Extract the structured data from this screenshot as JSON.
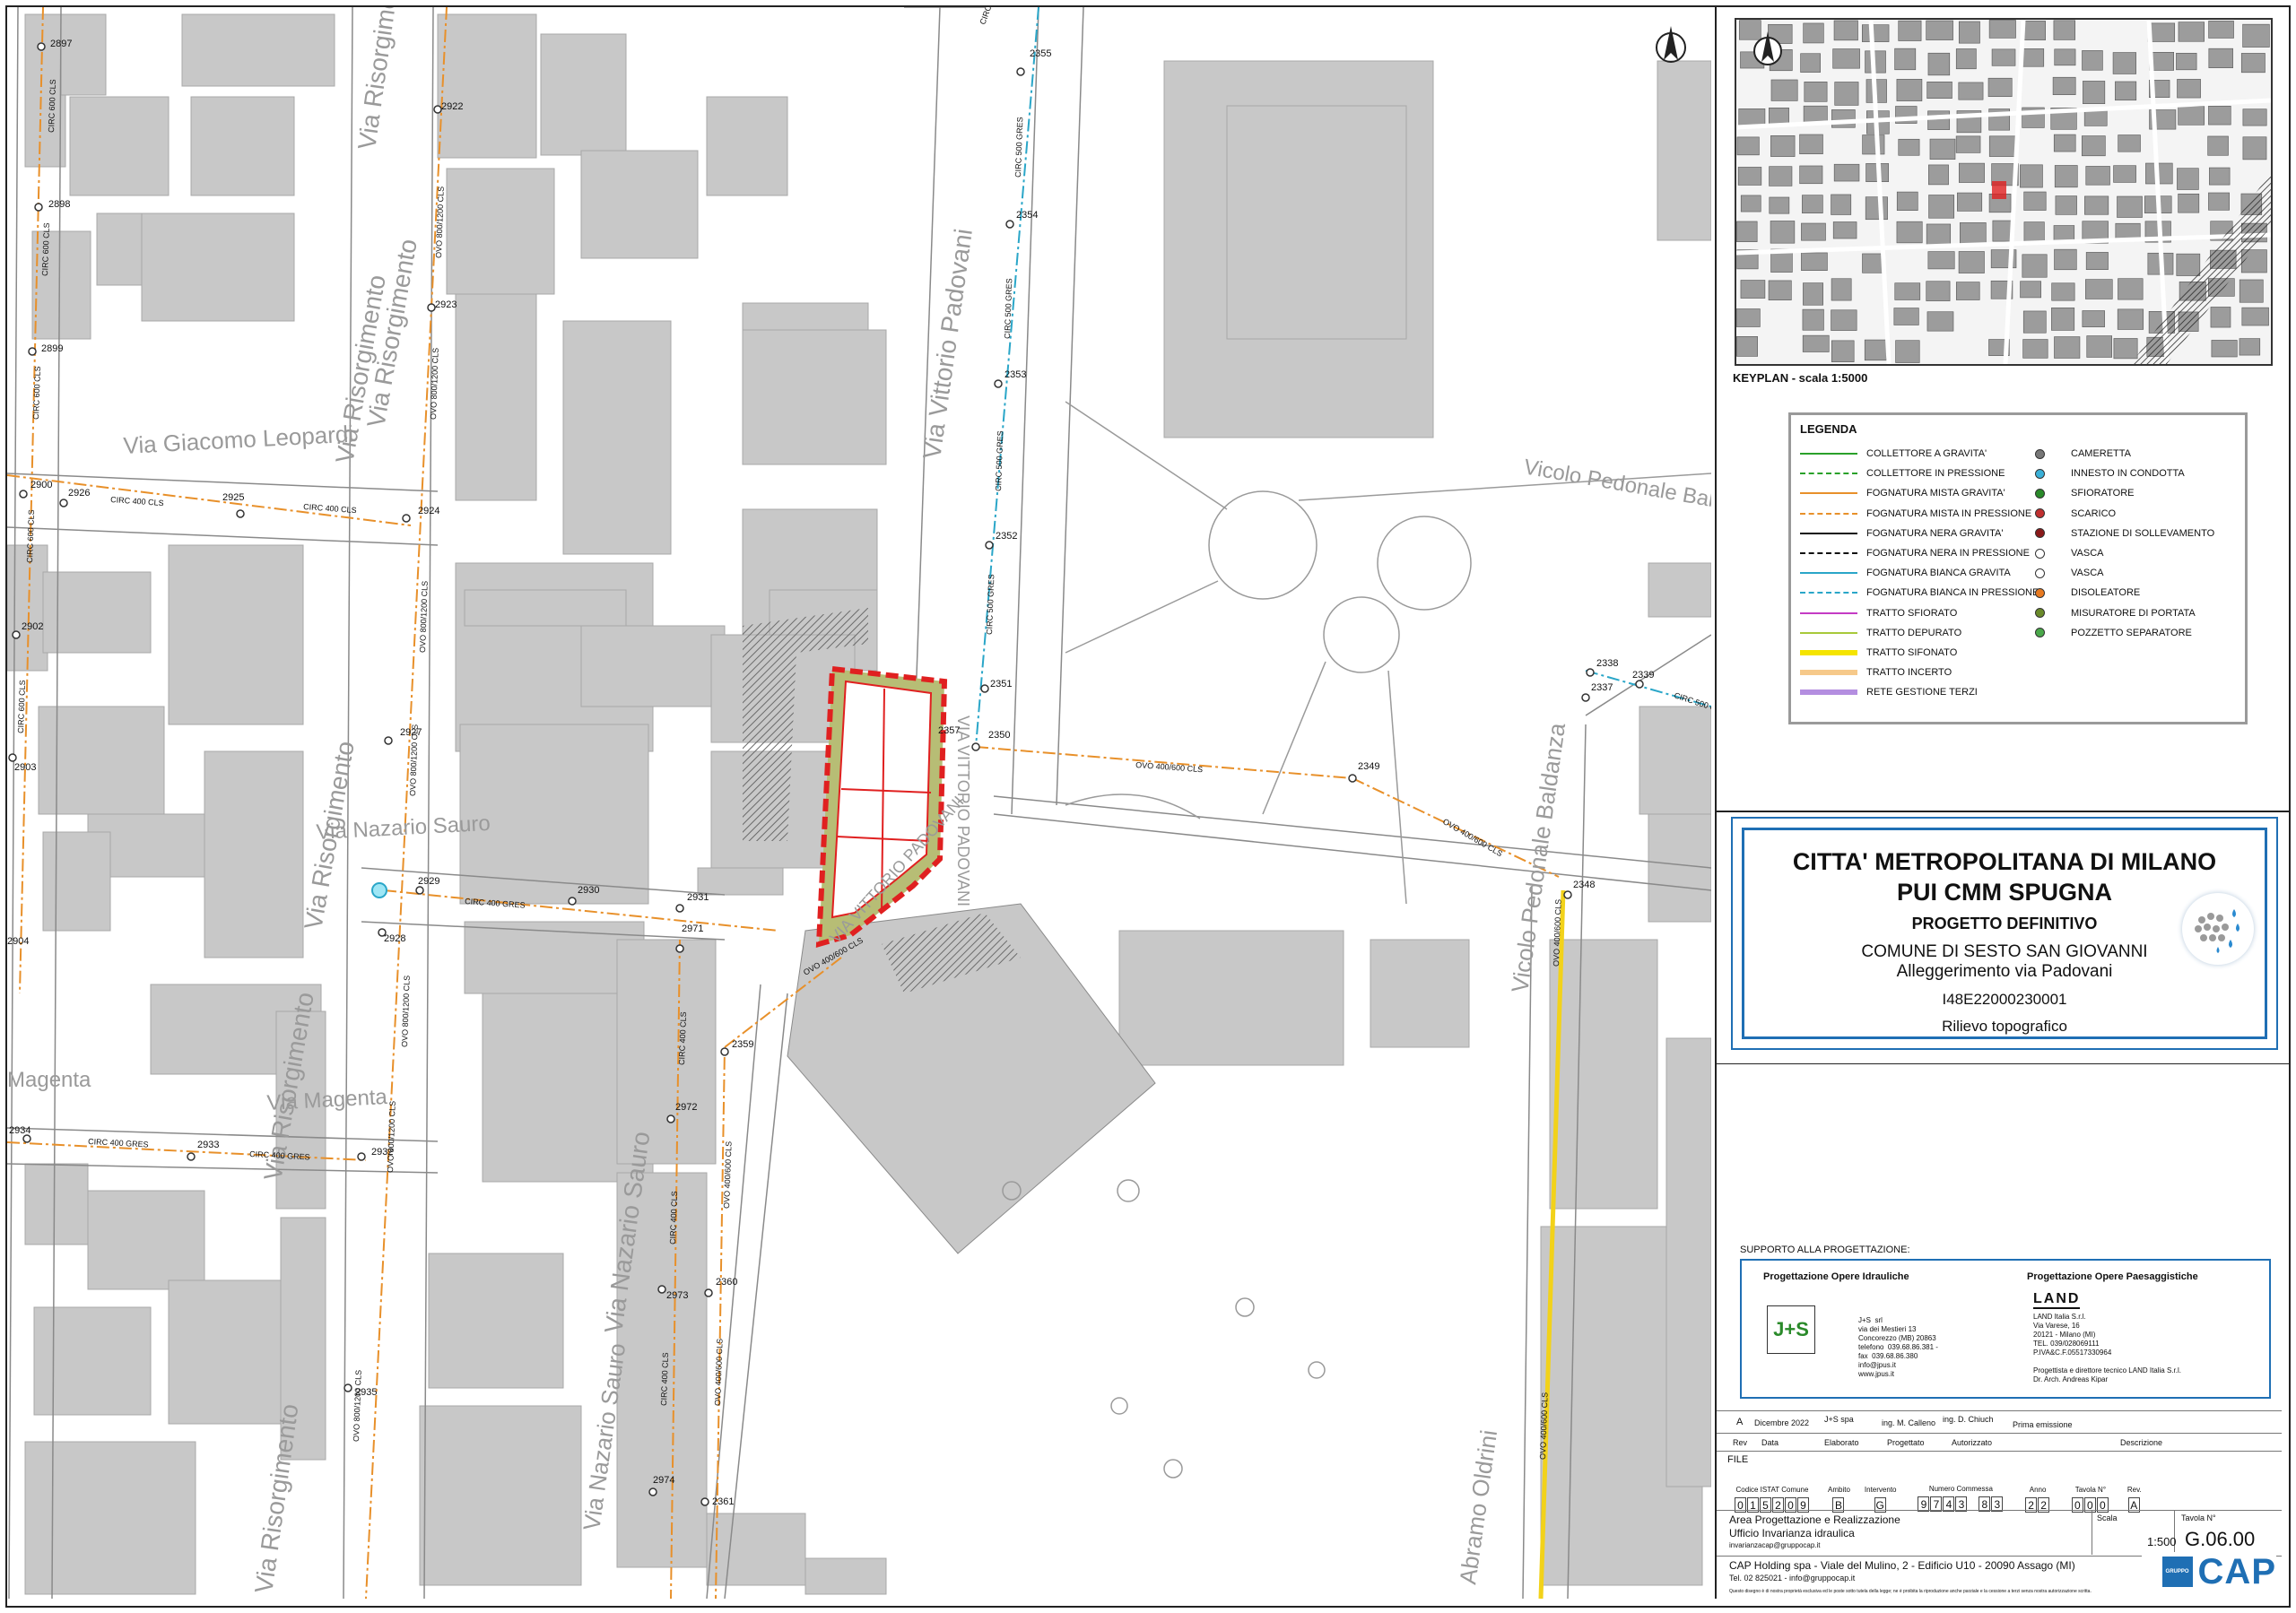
{
  "map": {
    "streets": [
      "Via Risorgimento",
      "Via Risorgimento",
      "Via Giacomo Leopardi",
      "Via Risorgimento",
      "Via Nazario Sauro",
      "Via Risorgimento",
      "Via Magenta",
      "Magenta",
      "Via Risorgimento",
      "Via Vittorio Padovani",
      "VIA VITTORIO PADOVANI",
      "VIA VITTORIO PADOVANI",
      "Vicolo Pedonale Bal",
      "Vicolo Pedonale Baldanza",
      "Via Nazario Sauro",
      "Via Nazario Sauro",
      "Abramo Oldrini",
      "Via Risorgimento"
    ],
    "nodes": [
      "2897",
      "2898",
      "2899",
      "2900",
      "2902",
      "2903",
      "2904",
      "2922",
      "2923",
      "2924",
      "2925",
      "2926",
      "2927",
      "2928",
      "2929",
      "2930",
      "2931",
      "2932",
      "2933",
      "2934",
      "2935",
      "2971",
      "2972",
      "2973",
      "2974",
      "2355",
      "2354",
      "2353",
      "2352",
      "2351",
      "2350",
      "2357",
      "2349",
      "2348",
      "2338",
      "2339",
      "2337",
      "2359",
      "2360",
      "2361"
    ],
    "pipe_labels": [
      "CIRC 600 CLS",
      "CIRC 600 CLS",
      "CIRC 600 CLS",
      "CIRC 600 CLS",
      "CIRC 600 CLS",
      "CIRC 400 CLS",
      "CIRC 400 CLS",
      "OVO 800/1200 CLS",
      "OVO 800/1200 CLS",
      "OVO 800/1200 CLS",
      "OVO 800/1200 CLS",
      "OVO 800/1200 CLS",
      "OVO 800/1200 CLS",
      "OVO 800/1200 CLS",
      "CIRC 400 GRES",
      "CIRC 400 GRES",
      "CIRC 400 GRES",
      "CIRC 400 CLS",
      "CIRC 400 CLS",
      "CIRC 400 CLS",
      "OVO 400/600 CLS",
      "OVO 400/600 CLS",
      "OVO 400/600 CLS",
      "OVO 400/600 CLS",
      "OVO 400/600 CLS",
      "OVO 400/600 CLS",
      "OVO 400/600 CLS",
      "CIRC 500 GRES",
      "CIRC 500 GRES",
      "CIRC 500 GRES",
      "CIRC 500 GRES",
      "CIRC 500 GRES",
      "CIRC 500 GRES"
    ],
    "colors": {
      "orange_pipe": "#e8902a",
      "cyan_pipe": "#2aa6c8",
      "yellow_pipe": "#f2d21a",
      "building": "#c8c8c8",
      "site": "#e02020"
    }
  },
  "keyplan": {
    "label": "KEYPLAN - scala 1:5000"
  },
  "legend": {
    "title": "LEGENDA",
    "lines": [
      {
        "label": "COLLETTORE A GRAVITA'",
        "color": "#2aa12a",
        "style": "solid"
      },
      {
        "label": "COLLETTORE IN PRESSIONE",
        "color": "#2aa12a",
        "style": "dashed"
      },
      {
        "label": "FOGNATURA MISTA GRAVITA'",
        "color": "#e8902a",
        "style": "solid"
      },
      {
        "label": "FOGNATURA MISTA IN PRESSIONE",
        "color": "#e8902a",
        "style": "dashed"
      },
      {
        "label": "FOGNATURA NERA GRAVITA'",
        "color": "#111111",
        "style": "solid"
      },
      {
        "label": "FOGNATURA NERA IN PRESSIONE",
        "color": "#111111",
        "style": "dashed"
      },
      {
        "label": "FOGNATURA BIANCA GRAVITA",
        "color": "#2aa6c8",
        "style": "solid"
      },
      {
        "label": "FOGNATURA BIANCA IN PRESSIONE",
        "color": "#2aa6c8",
        "style": "dashed"
      },
      {
        "label": "TRATTO SFIORATO",
        "color": "#c43bc4",
        "style": "solid"
      },
      {
        "label": "TRATTO DEPURATO",
        "color": "#a8c93a",
        "style": "solid"
      },
      {
        "label": "TRATTO SIFONATO",
        "color": "#f5e400",
        "style": "thick"
      },
      {
        "label": "TRATTO INCERTO",
        "color": "#f6c98a",
        "style": "thick"
      },
      {
        "label": "RETE GESTIONE TERZI",
        "color": "#b48ee0",
        "style": "thick"
      }
    ],
    "symbols": [
      {
        "label": "CAMERETTA",
        "color": "#777777"
      },
      {
        "label": "INNESTO IN CONDOTTA",
        "color": "#3ab0d8"
      },
      {
        "label": "SFIORATORE",
        "color": "#2a8a2a"
      },
      {
        "label": "SCARICO",
        "color": "#c03030"
      },
      {
        "label": "STAZIONE DI SOLLEVAMENTO",
        "color": "#8a1a1a"
      },
      {
        "label": "VASCA",
        "color": "#ffffff"
      },
      {
        "label": "VASCA",
        "color": "#ffffff"
      },
      {
        "label": "DISOLEATORE",
        "color": "#e87a20"
      },
      {
        "label": "MISURATORE DI PORTATA",
        "color": "#6a8a2a"
      },
      {
        "label": "POZZETTO SEPARATORE",
        "color": "#4aa84a"
      }
    ]
  },
  "title_block": {
    "line1": "CITTA' METROPOLITANA DI MILANO",
    "line2": "PUI CMM SPUGNA",
    "phase": "PROGETTO DEFINITIVO",
    "comune": "COMUNE DI SESTO SAN GIOVANNI",
    "subject": "Alleggerimento via Padovani",
    "cup": "I48E22000230001",
    "drawing": "Rilievo topografico"
  },
  "support": {
    "label": "SUPPORTO ALLA PROGETTAZIONE:",
    "left_title": "Progettazione Opere Idrauliche",
    "left_logo": "J+S",
    "left_text": "J+S  srl\nvia dei Mestieri 13\nConcorezzo (MB) 20863\ntelefono  039.68.86.381 -\nfax  039.68.86.380\ninfo@jpus.it\nwww.jpus.it",
    "right_title": "Progettazione Opere Paesaggistiche",
    "right_logo": "LAND",
    "right_text": "LAND Italia S.r.l.\nVia Varese, 16\n20121 - Milano (MI)\nTEL. 039/028069111\nP.IVA&C.F.05517330964\n\nProgettista e direttore tecnico LAND Italia S.r.l.\nDr. Arch. Andreas Kipar"
  },
  "revision": {
    "row": {
      "rev": "A",
      "data": "Dicembre 2022",
      "elaborato": "J+S spa",
      "progettato": "ing. M. Calleno",
      "autorizzato": "ing. D. Chiuch",
      "descrizione": "Prima emissione"
    },
    "headers": {
      "rev": "Rev",
      "data": "Data",
      "elaborato": "Elaborato",
      "progettato": "Progettato",
      "autorizzato": "Autorizzato",
      "descrizione": "Descrizione"
    }
  },
  "file": {
    "label": "FILE",
    "istat_label": "Codice ISTAT Comune",
    "istat": [
      "0",
      "1",
      "5",
      "2",
      "0",
      "9"
    ],
    "ambito_label": "Ambito",
    "ambito": "B",
    "intervento_label": "Intervento",
    "intervento": "G",
    "commessa_label": "Numero Commessa",
    "commessa_a": [
      "9",
      "7",
      "4",
      "3"
    ],
    "commessa_b": [
      "8",
      "3"
    ],
    "anno_label": "Anno",
    "anno": [
      "2",
      "2"
    ],
    "tavola_label": "Tavola N°",
    "tavola": [
      "0",
      "0",
      "0"
    ],
    "rev_label": "Rev.",
    "rev": "A"
  },
  "footer": {
    "area": "Area Progettazione e Realizzazione",
    "ufficio": "Ufficio Invarianza idraulica",
    "email": "invarianzacap@gruppocap.it",
    "scala_label": "Scala",
    "scala": "1:500",
    "tavola_label": "Tavola N°",
    "tavola": "G.06.00",
    "company": "CAP Holding spa - Viale del Mulino, 2 - Edificio U10 - 20090 Assago (MI)",
    "contacts": "Tel. 02 825021 - info@gruppocap.it",
    "disclaimer": "Questo disegno è di nostra proprietà esclusiva ed le poste sotto tutela della legge; ne è proibita la riproduzione anche parziale e la cessione a terzi senza nostra autorizzazione scritta.",
    "logo_group": "GRUPPO",
    "logo": "CAP"
  }
}
